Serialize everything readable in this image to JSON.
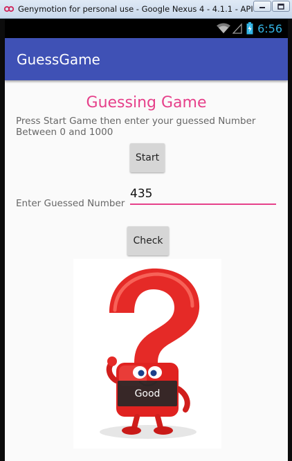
{
  "window": {
    "title": "Genymotion for personal use - Google Nexus 4 - 4.1.1 - API 1..."
  },
  "status_bar": {
    "time": "6:56",
    "icons": [
      "wifi-icon",
      "signal-icon",
      "battery-charging-icon"
    ]
  },
  "action_bar": {
    "title": "GuessGame"
  },
  "main": {
    "heading": "Guessing Game",
    "instructions": "Press  Start Game then enter your guessed Number Between 0 and 1000",
    "start_label": "Start",
    "guess_label": "Enter Guessed Number",
    "guess_value": "435",
    "check_label": "Check",
    "image_icon": "question-mark-character-icon"
  },
  "toast": {
    "message": "Good"
  },
  "colors": {
    "primary": "#3f51b5",
    "accent": "#e6408a",
    "status_time": "#33b5e5",
    "button": "#d6d6d6"
  }
}
